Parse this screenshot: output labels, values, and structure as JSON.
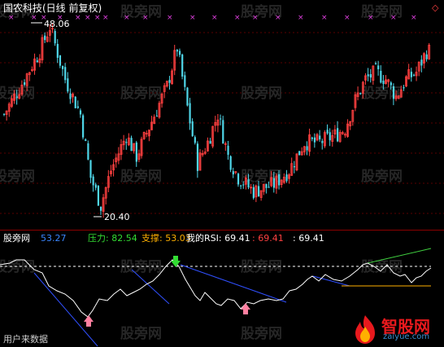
{
  "main_panel": {
    "title": "国农科技(日线 前复权)",
    "high_label": "48.06",
    "low_label": "20.40",
    "watermark": "股旁网"
  },
  "sub_panel": {
    "watermark": "股旁网",
    "indicator_name": "股旁网",
    "indicator_value": "53.27",
    "pressure_label": "压力: 82.54",
    "support_label": "支撑: 53.03",
    "rsi_label": "我的RSI: 69.41",
    "rsi_value_red": ": 69.41",
    "rsi_value_white": ": 69.41",
    "footer_label": "用户来数据"
  },
  "logo": {
    "name": "智股网",
    "url": "zaiyue.com"
  },
  "colors": {
    "up": "#ff4040",
    "down": "#4fd6e8",
    "label_blue": "#3a86ff",
    "label_green": "#33dd33",
    "label_orange": "#ffb000",
    "label_red": "#ff4040",
    "rsi_line": "#ffffff",
    "trend_blue": "#3050ff",
    "trend_green": "#40d040",
    "marker_magenta": "#e040e0",
    "dashed_level": "#ffffff"
  },
  "icons": {
    "buy_marker": "up-arrow-icon",
    "sell_marker": "down-arrow-icon",
    "top_signal": "x-mark-icon",
    "corner": "diamond-icon"
  }
}
